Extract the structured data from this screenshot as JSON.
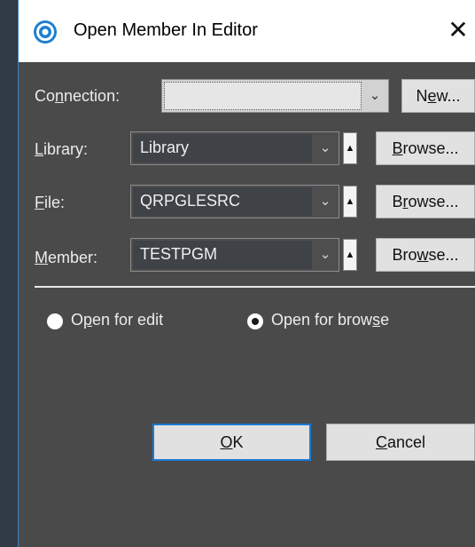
{
  "window": {
    "title": "Open Member In Editor",
    "close_glyph": "✕"
  },
  "connection": {
    "label_pre": "Co",
    "label_mnemonic": "n",
    "label_post": "nection:",
    "value": "",
    "new_button": {
      "pre": "N",
      "mnemonic": "e",
      "post": "w..."
    }
  },
  "library": {
    "label_mnemonic": "L",
    "label_post": "ibrary:",
    "value": "Library",
    "browse": {
      "pre": "",
      "mnemonic": "B",
      "post": "rowse..."
    }
  },
  "file": {
    "label_mnemonic": "F",
    "label_post": "ile:",
    "value": "QRPGLESRC",
    "browse": {
      "pre": "B",
      "mnemonic": "r",
      "post": "owse..."
    }
  },
  "member": {
    "label_mnemonic": "M",
    "label_post": "ember:",
    "value": "TESTPGM",
    "browse": {
      "pre": "Bro",
      "mnemonic": "w",
      "post": "se..."
    }
  },
  "options": {
    "edit": {
      "pre": "O",
      "mnemonic": "p",
      "post": "en for edit",
      "selected": false
    },
    "browse": {
      "pre": "Open for brow",
      "mnemonic": "s",
      "post": "e",
      "selected": true
    }
  },
  "buttons": {
    "ok": {
      "mnemonic": "O",
      "post": "K"
    },
    "cancel": {
      "mnemonic": "C",
      "post": "ancel"
    }
  },
  "icons": {
    "dropdown": "chevron-down-icon",
    "spin": "up-triangle-icon",
    "app": "app-logo-icon"
  },
  "colors": {
    "dialog_bg": "#4a4a4a",
    "accent": "#1a7ad6",
    "input_bg": "#3f4246"
  }
}
